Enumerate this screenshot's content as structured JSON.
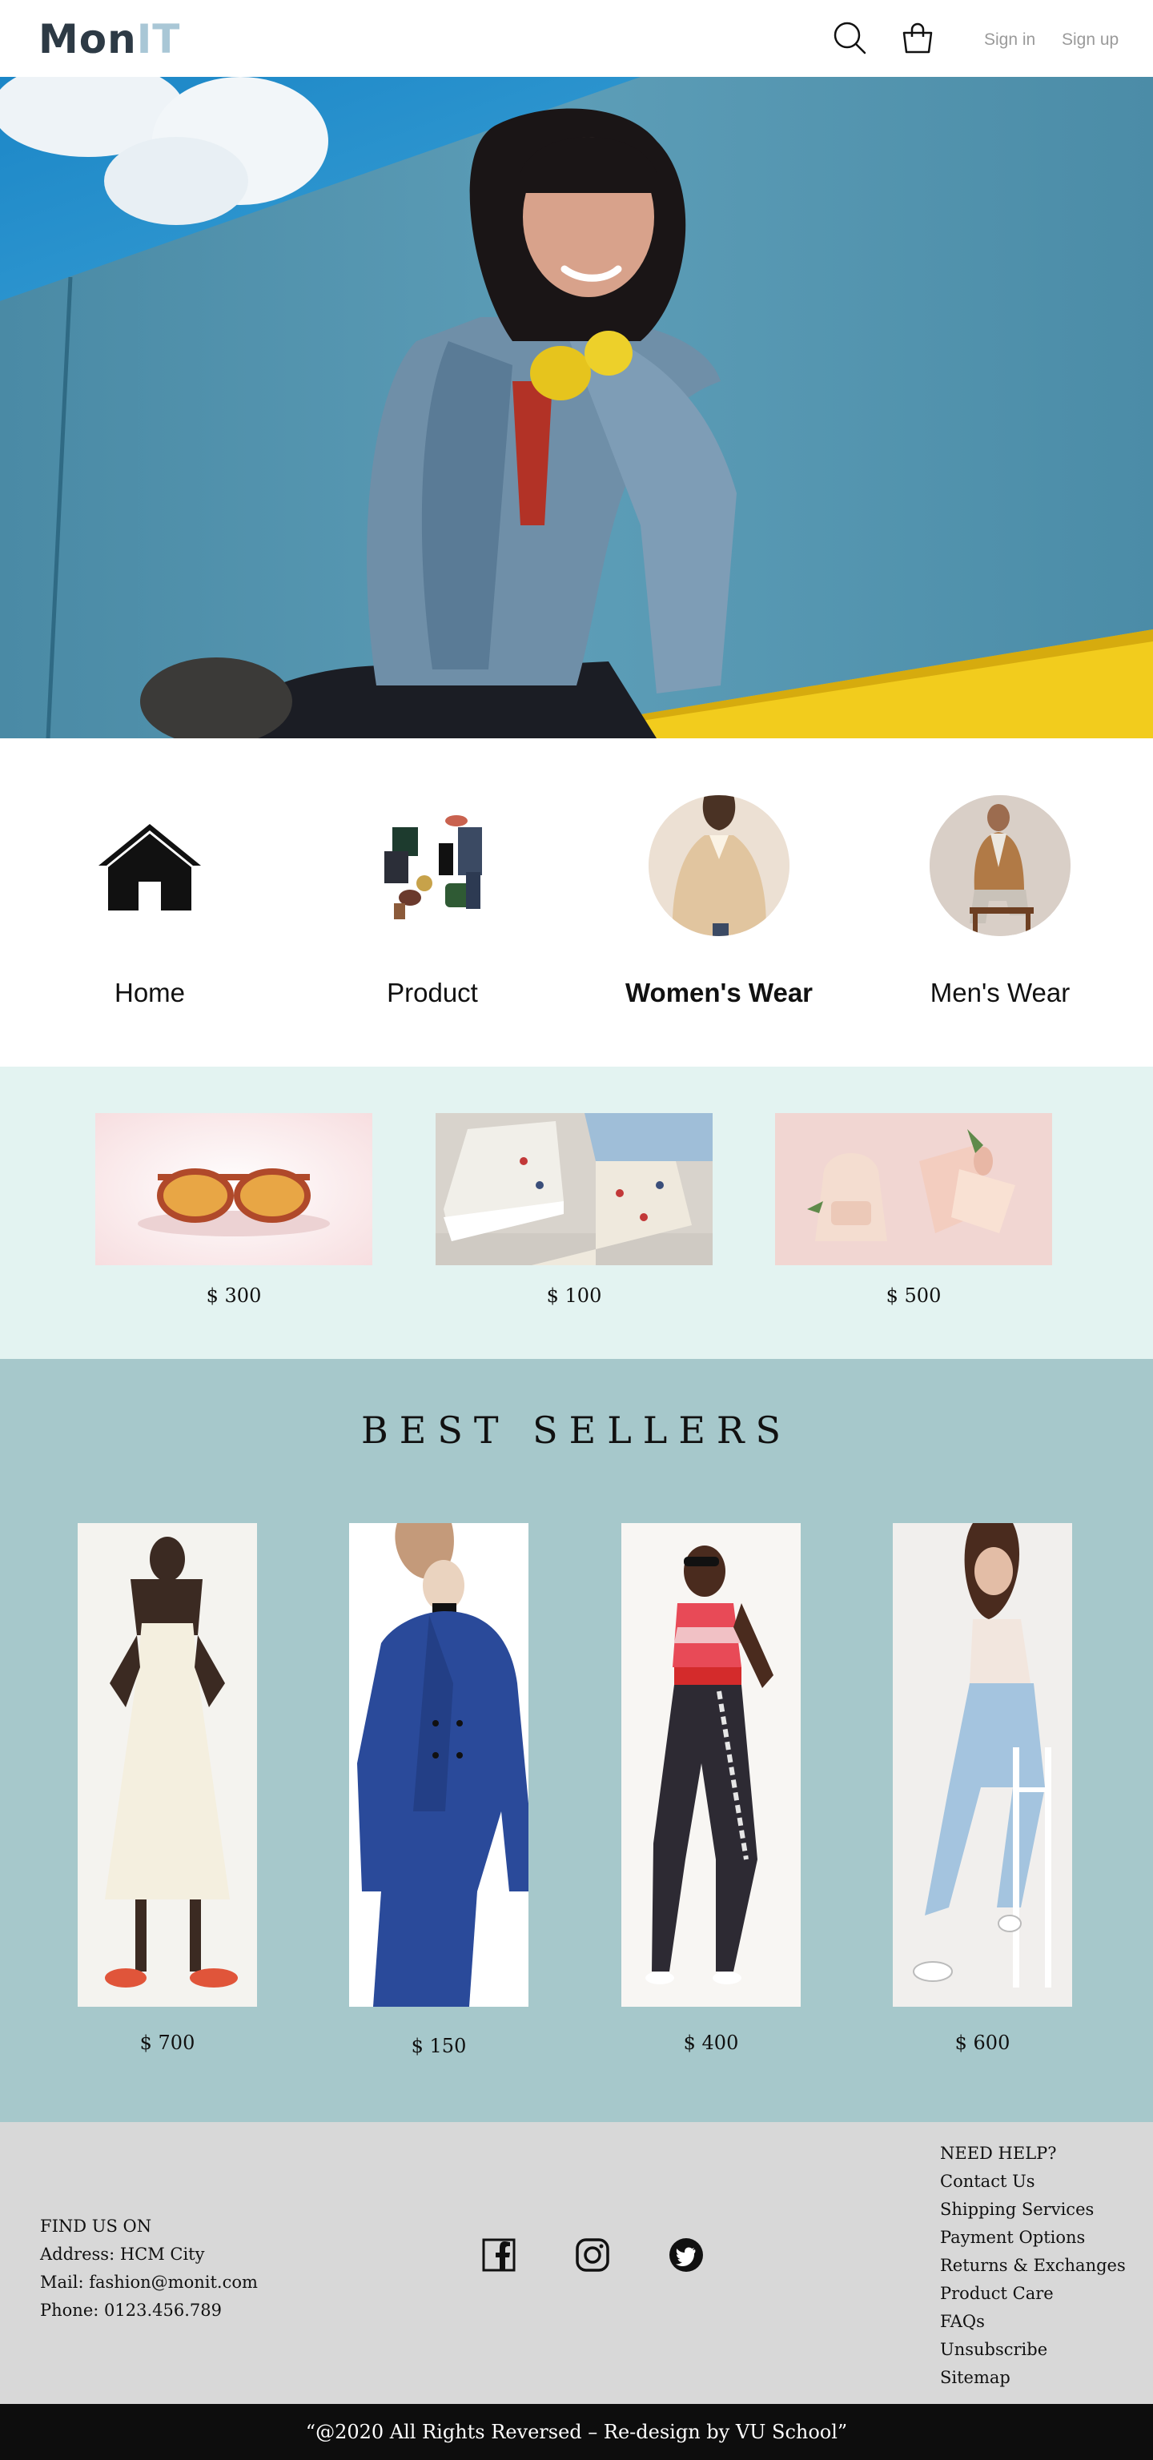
{
  "header": {
    "logo_part1": "Mon",
    "logo_part2": "IT",
    "signin_label": "Sign in",
    "signup_label": "Sign up"
  },
  "categories": [
    {
      "label": "Home"
    },
    {
      "label": "Product"
    },
    {
      "label": "Women's Wear"
    },
    {
      "label": "Men's Wear"
    }
  ],
  "featured": [
    {
      "price": "$ 300"
    },
    {
      "price": "$ 100"
    },
    {
      "price": "$ 500"
    }
  ],
  "best_sellers": {
    "title": "BEST SELLERS",
    "items": [
      {
        "price": "$ 700"
      },
      {
        "price": "$ 150"
      },
      {
        "price": "$ 400"
      },
      {
        "price": "$ 600"
      }
    ]
  },
  "footer": {
    "contact": {
      "heading": "FIND US ON",
      "address": "Address: HCM City",
      "mail": "Mail: fashion@monit.com",
      "phone": "Phone: 0123.456.789"
    },
    "help_heading": "NEED HELP?",
    "help_links": [
      "Contact Us",
      "Shipping Services",
      "Payment Options",
      "Returns & Exchanges",
      "Product Care",
      "FAQs",
      "Unsubscribe",
      "Sitemap"
    ],
    "copyright": "“@2020 All Rights Reversed – Re-design by VU School”"
  },
  "icons": {
    "search": "search-icon",
    "cart": "shopping-bag-icon",
    "home": "house-icon",
    "facebook": "facebook-icon",
    "instagram": "instagram-icon",
    "twitter": "twitter-icon"
  },
  "colors": {
    "featured_bg": "#e3f3f1",
    "best_sellers_bg": "#a6c8cb",
    "footer_bg": "#d8d8d8",
    "copyright_bg": "#0d0d0d"
  }
}
